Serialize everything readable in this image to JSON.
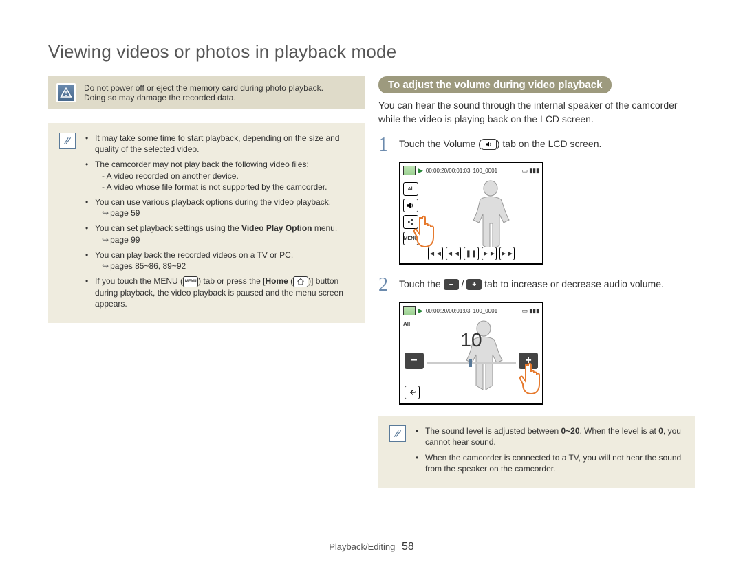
{
  "page": {
    "title": "Viewing videos or photos in playback mode",
    "footer_section": "Playback/Editing",
    "page_number": "58"
  },
  "left": {
    "warning_line1": "Do not power off or eject the memory card during photo playback.",
    "warning_line2": "Doing so may damage the recorded data.",
    "notes": {
      "n1": "It may take some time to start playback, depending on the size and quality of the selected video.",
      "n2": "The camcorder may not play back the following video files:",
      "n2a": "- A video recorded on another device.",
      "n2b": "- A video whose file format is not supported by the camcorder.",
      "n3": "You can use various playback options during the video playback.",
      "n3ref": "page 59",
      "n4a": "You can set playback settings using the ",
      "n4b": "Video Play Option",
      "n4c": " menu.",
      "n4ref": "page 99",
      "n5": "You can play back the recorded videos on a TV or PC.",
      "n5ref": "pages 85~86, 89~92",
      "n6a": "If you touch the MENU (",
      "n6b": ") tab or press the [",
      "n6c": "Home",
      "n6d": " (",
      "n6e": ")] button during playback, the video playback is paused and the menu screen appears.",
      "menu_label": "MENU"
    }
  },
  "right": {
    "heading": "To adjust the volume during video playback",
    "intro": "You can hear the sound through the internal speaker of the camcorder while the video is playing back on the LCD screen.",
    "step1_a": "Touch the Volume (",
    "step1_b": ") tab on the LCD screen.",
    "step2_a": "Touch the ",
    "step2_b": " / ",
    "step2_c": " tab to increase or decrease audio volume.",
    "lcd": {
      "timecode": "00:00:20/00:01:03",
      "clip_id": "100_0001",
      "all_label": "All",
      "menu_label": "MENU",
      "volume_value": "10"
    },
    "notes": {
      "n1a": "The sound level is adjusted between ",
      "n1b": "0~20",
      "n1c": ". When the level is at ",
      "n1d": "0",
      "n1e": ", you cannot hear sound.",
      "n2": "When the camcorder is connected to a TV, you will not hear the sound from the speaker on the camcorder."
    }
  }
}
